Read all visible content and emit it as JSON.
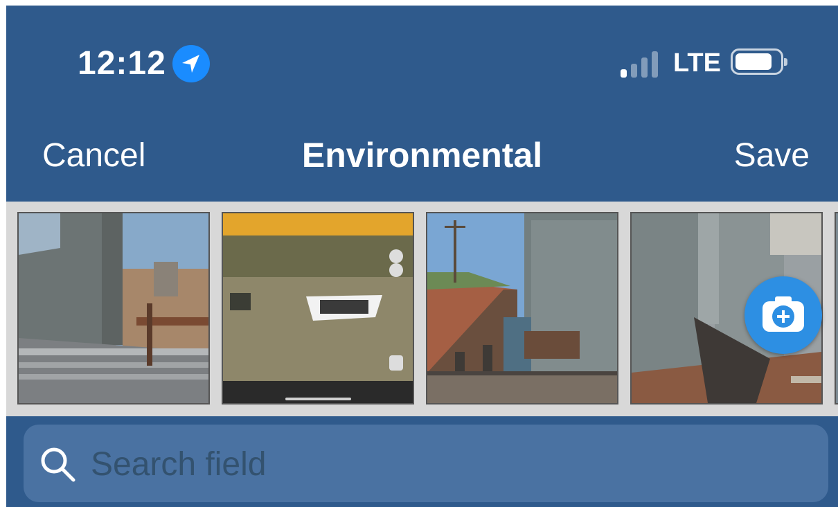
{
  "status_bar": {
    "time": "12:12",
    "network": "LTE",
    "icons": [
      "location-arrow-icon",
      "signal-icon",
      "battery-icon"
    ]
  },
  "nav": {
    "cancel_label": "Cancel",
    "title": "Environmental",
    "save_label": "Save"
  },
  "photos": [
    {
      "name": "photo-1"
    },
    {
      "name": "photo-2"
    },
    {
      "name": "photo-3"
    },
    {
      "name": "photo-4"
    }
  ],
  "add_photo_icon": "camera-plus-icon",
  "search": {
    "placeholder": "Search field",
    "value": ""
  },
  "colors": {
    "bar_background": "#2f5a8c",
    "search_background": "#4a72a2",
    "accent_blue": "#2d8fe3",
    "location_blue": "#1a8cff"
  }
}
